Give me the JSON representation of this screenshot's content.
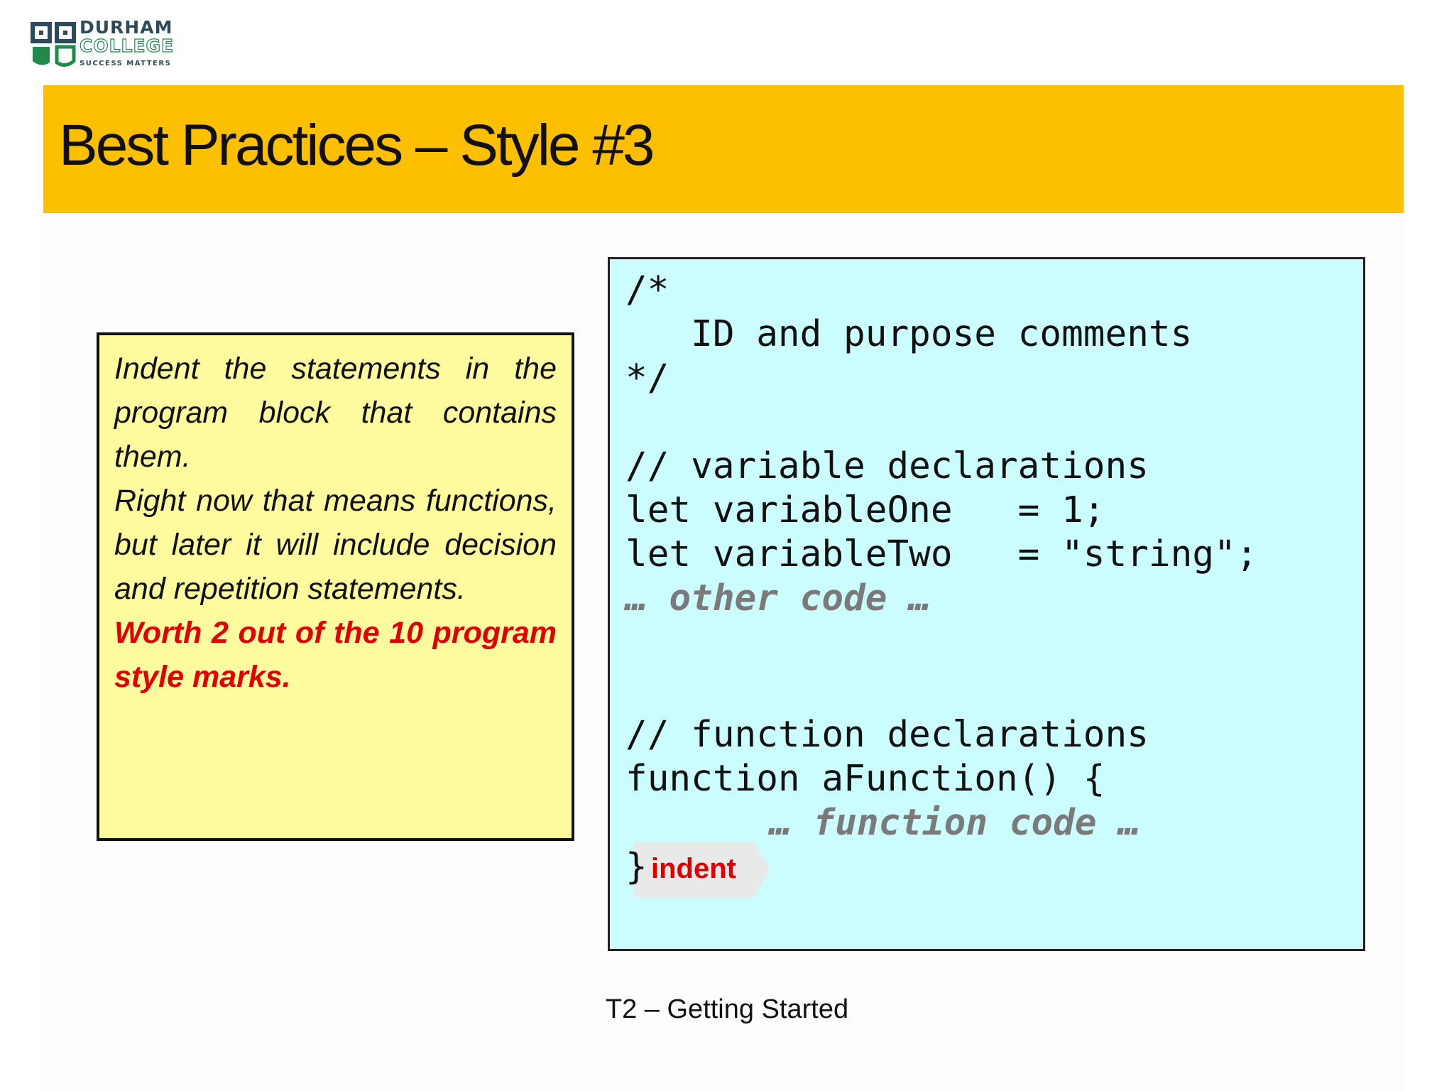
{
  "logo": {
    "line1": "DURHAM",
    "line2": "COLLEGE",
    "line3": "SUCCESS MATTERS",
    "icon": "durham-college-shield-icon",
    "colors": {
      "navy": "#2b4a5b",
      "green": "#1f8a4c"
    }
  },
  "title": "Best Practices – Style #3",
  "note": {
    "paragraph1": "Indent the statements in the program block that contains them.",
    "paragraph2": "Right now that means functions, but later it will include decision and repetition statements.",
    "paragraph3": "Worth 2 out of the 10 program style marks."
  },
  "code": {
    "line1": "/*",
    "line2": "   ID and purpose comments",
    "line3": "*/",
    "line4": "// variable declarations",
    "line5": "let variableOne   = 1;",
    "line6": "let variableTwo   = \"string\";",
    "line7": "… other code …",
    "line8": "// function declarations",
    "line9": "function aFunction() {",
    "line10": "… function code …",
    "line11": "}"
  },
  "indent_label": "indent",
  "footer": "T2 – Getting Started",
  "colors": {
    "title_bar": "#fcc000",
    "note_bg": "#fdfb9e",
    "code_bg": "#ccfdfe",
    "accent_red": "#e00000",
    "code_grey": "#7a7a7a"
  }
}
